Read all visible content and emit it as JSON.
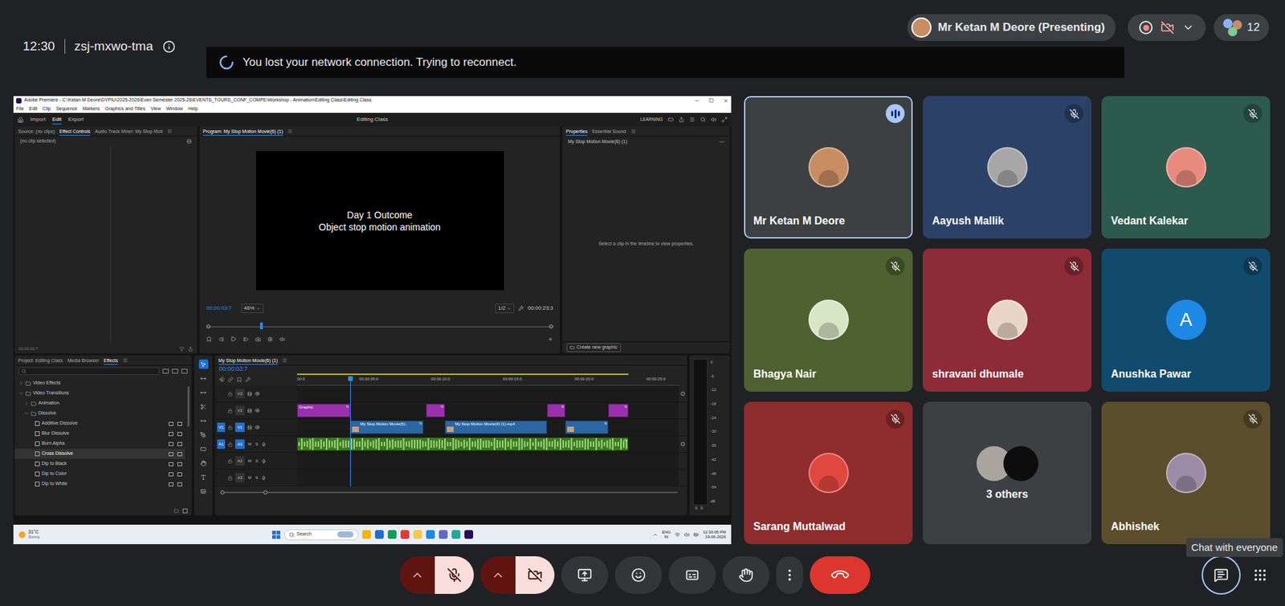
{
  "meeting": {
    "time": "12:30",
    "code": "zsj-mxwo-tma"
  },
  "banner": {
    "text": "You lost your network connection. Trying to reconnect."
  },
  "presenter": {
    "label": "Mr Ketan M Deore (Presenting)"
  },
  "header_controls": {
    "recording": true,
    "participants_count": "12"
  },
  "premiere": {
    "title": "Adobe Premiere - C:\\Ketan M Deore\\DYPIU\\2025-2026\\Even Semester 2025-26\\EVENTS_TOURS_CONF_COMPE\\Workshop - Animation\\Editing Class\\Editing Class",
    "menu": [
      "File",
      "Edit",
      "Clip",
      "Sequence",
      "Markers",
      "Graphics and Titles",
      "View",
      "Window",
      "Help"
    ],
    "workspaces": [
      {
        "label": "Import",
        "selected": false
      },
      {
        "label": "Edit",
        "selected": true
      },
      {
        "label": "Export",
        "selected": false
      }
    ],
    "project_title": "Editing Class",
    "learning": "LEARNING",
    "source_tabs": [
      {
        "label": "Source: (no clips)",
        "selected": false
      },
      {
        "label": "Effect Controls",
        "selected": true
      },
      {
        "label": "Audio Track Mixer: My Stop Moti",
        "selected": false
      }
    ],
    "source_empty": "(no clip selected)",
    "source_timecode": "00:00:03:7",
    "program": {
      "tab": "Program: My Stop Motion Movie(6) (1)",
      "frame_lines": [
        "Day 1 Outcome",
        "Object stop motion animation"
      ],
      "timecode": "00:00:03:7",
      "zoom": "46%",
      "resolution": "1/2",
      "duration": "00:00:23:3",
      "playhead": 0.155
    },
    "properties": {
      "tabs": [
        {
          "label": "Properties",
          "selected": true
        },
        {
          "label": "Essential Sound",
          "selected": false
        }
      ],
      "item": "My Stop Motion Movie(6) (1)",
      "hint": "Select a clip in the timeline to view properties.",
      "button": "Create new graphic"
    },
    "project_tabs": [
      {
        "label": "Project: Editing Class",
        "selected": false
      },
      {
        "label": "Media Browser",
        "selected": false
      },
      {
        "label": "Effects",
        "selected": true
      }
    ],
    "effects_tree": [
      {
        "label": "Video Effects",
        "depth": 0,
        "kind": "folder",
        "expanded": false,
        "selected": false
      },
      {
        "label": "Video Transitions",
        "depth": 0,
        "kind": "folder",
        "expanded": true,
        "selected": false
      },
      {
        "label": "Animation",
        "depth": 1,
        "kind": "folder",
        "expanded": false,
        "selected": false
      },
      {
        "label": "Dissolve",
        "depth": 1,
        "kind": "folder",
        "expanded": true,
        "selected": false
      },
      {
        "label": "Additive Dissolve",
        "depth": 2,
        "kind": "effect",
        "selected": false
      },
      {
        "label": "Blur Dissolve",
        "depth": 2,
        "kind": "effect",
        "selected": false
      },
      {
        "label": "Burn Alpha",
        "depth": 2,
        "kind": "effect",
        "selected": false
      },
      {
        "label": "Cross Dissolve",
        "depth": 2,
        "kind": "effect",
        "selected": true
      },
      {
        "label": "Dip to Black",
        "depth": 2,
        "kind": "effect",
        "selected": false
      },
      {
        "label": "Dip to Color",
        "depth": 2,
        "kind": "effect",
        "selected": false
      },
      {
        "label": "Dip to White",
        "depth": 2,
        "kind": "effect",
        "selected": false
      }
    ],
    "timeline": {
      "tab": "My Stop Motion Movie(6) (1)",
      "timecode": "00:00:03:7",
      "ruler": [
        "00:0",
        "00:00:05:0",
        "00:00:10:0",
        "00:00:15:0",
        "00:00:20:0",
        "00:00:25:0"
      ],
      "ruler_step_seconds": 5,
      "span_seconds": 26.6,
      "playhead_seconds": 3.7,
      "audio_buttons": [
        "M",
        "S"
      ],
      "fx_badge": "fx",
      "tracks": [
        {
          "label": "V3",
          "kind": "video",
          "patch": "",
          "targeted": false
        },
        {
          "label": "V2",
          "kind": "video",
          "patch": "",
          "targeted": false
        },
        {
          "label": "V1",
          "kind": "video",
          "patch": "V1",
          "targeted": true
        },
        {
          "label": "A1",
          "kind": "audio",
          "patch": "A1",
          "targeted": true
        },
        {
          "label": "A2",
          "kind": "audio",
          "patch": "",
          "targeted": false
        },
        {
          "label": "A3",
          "kind": "audio",
          "patch": "",
          "targeted": false
        }
      ],
      "clips": [
        {
          "track": "V2",
          "label": "Graphic",
          "start": 0,
          "end": 3.7,
          "fx": true,
          "kind": "graphic",
          "color": "#9a30ae"
        },
        {
          "track": "V2",
          "label": "",
          "start": 9.0,
          "end": 10.3,
          "fx": true,
          "kind": "graphic",
          "color": "#9a30ae"
        },
        {
          "track": "V2",
          "label": "",
          "start": 17.4,
          "end": 18.7,
          "fx": true,
          "kind": "graphic",
          "color": "#9a30ae"
        },
        {
          "track": "V2",
          "label": "",
          "start": 21.7,
          "end": 23.1,
          "fx": true,
          "kind": "graphic",
          "color": "#9a30ae"
        },
        {
          "track": "V1",
          "label": "My Stop Motion Movie(5)..",
          "start": 3.7,
          "end": 8.8,
          "fx": true,
          "kind": "video",
          "color": "#2a67a3"
        },
        {
          "track": "V1",
          "label": "My Stop Motion Movie(4) (1).mp4",
          "start": 10.3,
          "end": 17.4,
          "fx": false,
          "kind": "video",
          "color": "#2a67a3"
        },
        {
          "track": "V1",
          "label": "",
          "start": 18.7,
          "end": 21.7,
          "fx": true,
          "kind": "video",
          "color": "#2a67a3"
        },
        {
          "track": "A1",
          "label": "",
          "start": 0,
          "end": 23.1,
          "fx": true,
          "kind": "audio",
          "color": "#3b7a1e"
        }
      ]
    },
    "meter_ticks": [
      "0",
      "-6",
      "-12",
      "-18",
      "-24",
      "-30",
      "-36",
      "-42",
      "-48",
      "-54",
      "dB"
    ],
    "meter_labels": [
      "S",
      "S"
    ],
    "taskbar": {
      "weather_temp": "31°C",
      "weather_desc": "Sunny",
      "search": "Search",
      "lang": [
        "ENG",
        "IN"
      ],
      "time": "12:30:05 PM",
      "date": "19-06-2026"
    }
  },
  "tiles": [
    {
      "kind": "person",
      "name": "Mr Ketan M Deore",
      "muted": false,
      "speaking": true,
      "selected": true,
      "color": "#3c4043",
      "avatar": {
        "kind": "photo",
        "text": "",
        "color": "#c98d62"
      }
    },
    {
      "kind": "person",
      "name": "Aayush Mallik",
      "muted": true,
      "speaking": false,
      "selected": false,
      "color": "#2b4168",
      "avatar": {
        "kind": "photo",
        "text": "",
        "color": "#a7a7a7"
      }
    },
    {
      "kind": "person",
      "name": "Vedant Kalekar",
      "muted": true,
      "speaking": false,
      "selected": false,
      "color": "#2c5a4d",
      "avatar": {
        "kind": "photo",
        "text": "",
        "color": "#e98a7e"
      }
    },
    {
      "kind": "person",
      "name": "Bhagya Nair",
      "muted": true,
      "speaking": false,
      "selected": false,
      "color": "#4f6131",
      "avatar": {
        "kind": "photo",
        "text": "",
        "color": "#d7e6c4"
      }
    },
    {
      "kind": "person",
      "name": "shravani dhumale",
      "muted": true,
      "speaking": false,
      "selected": false,
      "color": "#8d2b37",
      "avatar": {
        "kind": "photo",
        "text": "",
        "color": "#ead5c9"
      }
    },
    {
      "kind": "person",
      "name": "Anushka Pawar",
      "muted": true,
      "speaking": false,
      "selected": false,
      "color": "#104b6d",
      "avatar": {
        "kind": "letter",
        "text": "A",
        "color": "#1e88e5"
      }
    },
    {
      "kind": "person",
      "name": "Sarang Muttalwad",
      "muted": true,
      "speaking": false,
      "selected": false,
      "color": "#8e2c2e",
      "avatar": {
        "kind": "photo",
        "text": "",
        "color": "#e0483f"
      }
    },
    {
      "kind": "group",
      "name": "3 others",
      "selected": false,
      "color": "#3c4043",
      "avatars": [
        "#aaa59e",
        "#0d0d0d"
      ]
    },
    {
      "kind": "person",
      "name": "Abhishek",
      "muted": true,
      "speaking": false,
      "selected": false,
      "color": "#5b4e2c",
      "avatar": {
        "kind": "photo",
        "text": "",
        "color": "#9c8ba6"
      }
    }
  ],
  "controls": {
    "microphone": {
      "on": false
    },
    "camera": {
      "on": false
    },
    "chat": {
      "selected": true
    }
  },
  "tooltip": "Chat with everyone"
}
